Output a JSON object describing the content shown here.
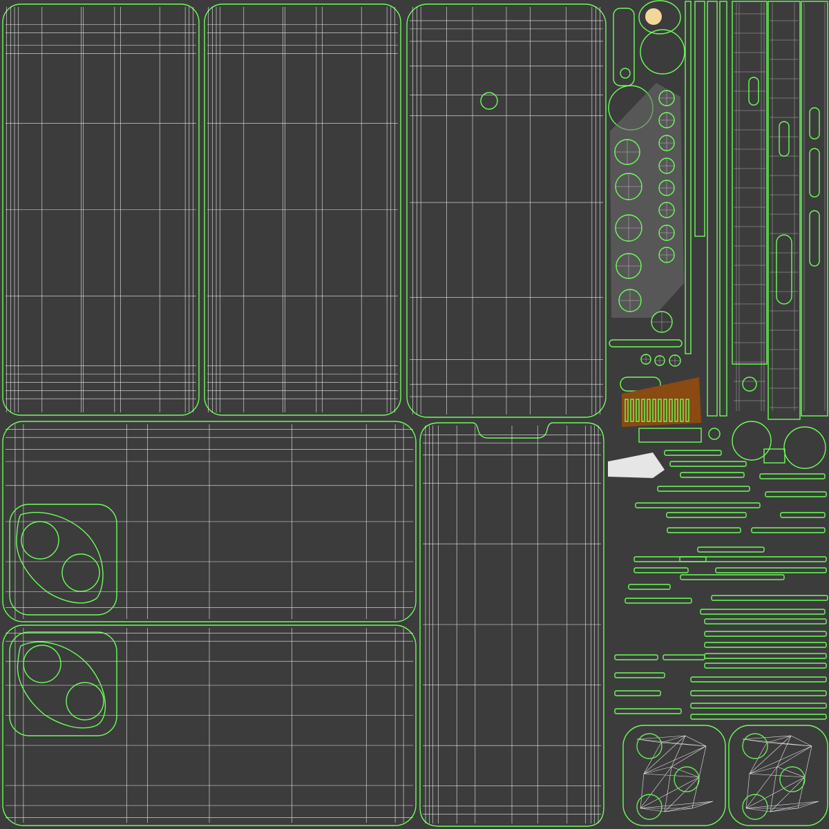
{
  "texture": {
    "background_color": "#3c3c3c",
    "edge_color": "#6cff5a",
    "wire_color": "#ffffff",
    "fill_colors": {
      "screen_dark": "#151515",
      "screen_black": "#000000",
      "back_gray": "#8c8c8c",
      "frame_gray": "#4a4a4a",
      "lens_black": "#121212",
      "part_light": "#cfcfcf",
      "part_mid": "#6e6e6e",
      "dark_slot": "#2a2a2a",
      "orange_board": "#8a4a12"
    }
  },
  "islands": {
    "large_screen_panels": 3,
    "back_panels": 2,
    "lens_clusters": 2,
    "camera_rings": 4,
    "small_circles": 10,
    "button_circles": 5,
    "bottom_pads": 2
  }
}
